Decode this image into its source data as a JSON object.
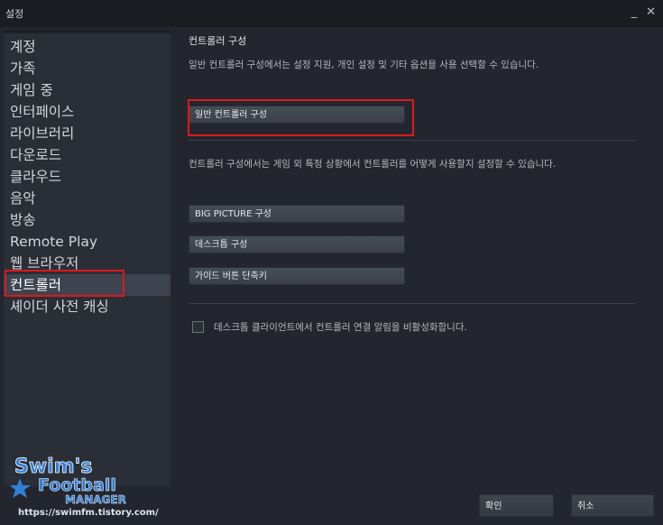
{
  "window": {
    "title": "설정",
    "controls": [
      "_",
      "✕"
    ]
  },
  "sidebar": {
    "items": [
      {
        "label": "계정"
      },
      {
        "label": "가족"
      },
      {
        "label": "게임 중"
      },
      {
        "label": "인터페이스"
      },
      {
        "label": "라이브러리"
      },
      {
        "label": "다운로드"
      },
      {
        "label": "클라우드"
      },
      {
        "label": "음악"
      },
      {
        "label": "방송"
      },
      {
        "label": "Remote Play"
      },
      {
        "label": "웹 브라우저"
      },
      {
        "label": "컨트롤러",
        "active": true
      },
      {
        "label": "셰이더 사전 캐싱"
      }
    ]
  },
  "content": {
    "section_title": "컨트롤러 구성",
    "general_desc": "일반 컨트롤러 구성에서는 설정 지원, 개인 설정 및 기타 옵션을 사용 선택할 수 있습니다.",
    "general_button": "일반 컨트롤러 구성",
    "context_desc": "컨트롤러 구성에서는 게임 외 특정 상황에서 컨트롤러를 어떻게 사용할지 설정할 수 있습니다.",
    "context_buttons": [
      "BIG PICTURE 구성",
      "데스크톱 구성",
      "가이드 버튼 단축키"
    ],
    "checkbox_label": "데스크톱 클라이언트에서 컨트롤러 연결 알림을 비활성화합니다.",
    "checkbox_checked": false
  },
  "footer": {
    "ok_label": "확인",
    "cancel_label": "취소"
  },
  "watermark": {
    "line1": "Swim's",
    "line2": "Football",
    "line3": "MANAGER",
    "url": "https://swimfm.tistory.com/"
  },
  "colors": {
    "highlight": "#e0171a",
    "active_item": "#3d4450",
    "background": "#23262e"
  }
}
